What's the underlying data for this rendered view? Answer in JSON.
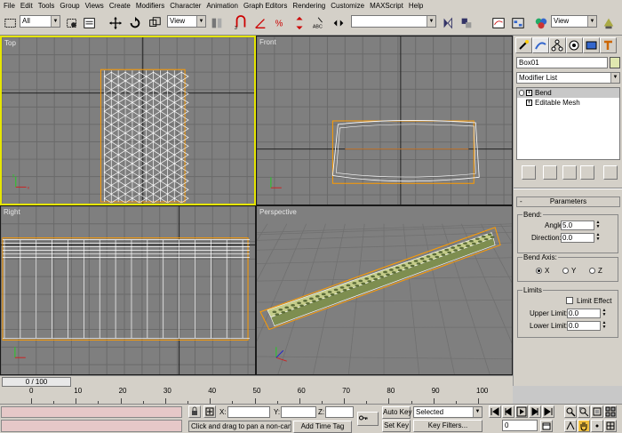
{
  "menu": [
    "File",
    "Edit",
    "Tools",
    "Group",
    "Views",
    "Create",
    "Modifiers",
    "Character",
    "Animation",
    "Graph Editors",
    "Rendering",
    "Customize",
    "MAXScript",
    "Help"
  ],
  "toolbar": {
    "selection_filter": "All",
    "ref_coord": "View",
    "named_selection": "",
    "render_view": "View"
  },
  "viewports": {
    "top_label": "Top",
    "front_label": "Front",
    "right_label": "Right",
    "perspective_label": "Perspective"
  },
  "command_panel": {
    "object_name": "Box01",
    "modifier_list": "Modifier List",
    "stack": [
      {
        "label": "Bend",
        "selected": true
      },
      {
        "label": "Editable Mesh",
        "selected": false
      }
    ],
    "rollout_title": "Parameters",
    "bend_group": "Bend:",
    "angle_label": "Angle:",
    "angle_value": "5.0",
    "direction_label": "Direction:",
    "direction_value": "0.0",
    "axis_group": "Bend Axis:",
    "axis_x": "X",
    "axis_y": "Y",
    "axis_z": "Z",
    "selected_axis": "X",
    "limits_group": "Limits",
    "limit_effect_label": "Limit Effect",
    "limit_effect_checked": false,
    "upper_label": "Upper Limit:",
    "upper_value": "0.0",
    "lower_label": "Lower Limit:",
    "lower_value": "0.0"
  },
  "timeline": {
    "slider_label": "0 / 100",
    "ruler_labels": [
      "0",
      "10",
      "20",
      "30",
      "40",
      "50",
      "60",
      "70",
      "80",
      "90",
      "100"
    ]
  },
  "status": {
    "x_label": "X:",
    "y_label": "Y:",
    "z_label": "Z:",
    "x_value": "",
    "y_value": "",
    "z_value": "",
    "prompt": "Click and drag to pan a non-camera",
    "add_time_tag": "Add Time Tag",
    "auto_key": "Auto Key",
    "set_key": "Set Key",
    "key_mode": "Selected",
    "key_filters": "Key Filters...",
    "frame": "0"
  },
  "colors": {
    "viewport_bg": "#7f7f7f",
    "active_border": "#e6e600",
    "wire": "#ffffff",
    "bbox": "#ff9c00",
    "mesh_fill": "#9fb070"
  }
}
